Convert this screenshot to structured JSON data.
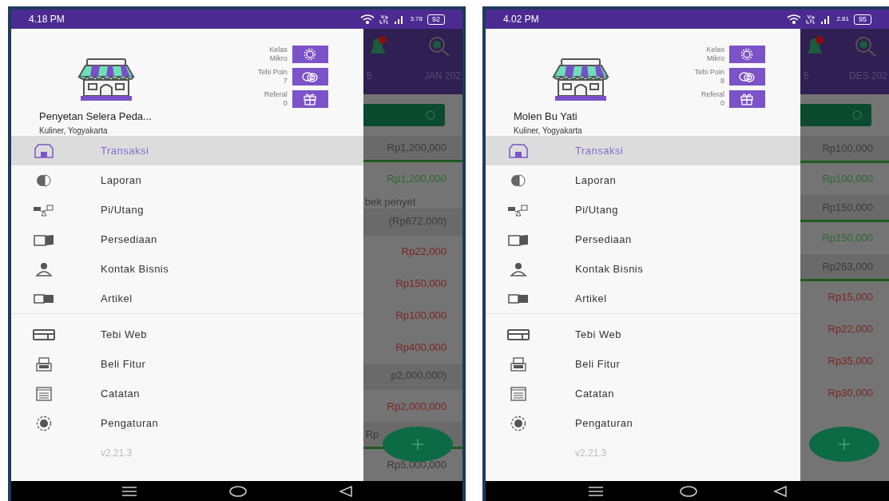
{
  "phones": [
    {
      "status_bar": {
        "time": "4.18 PM",
        "speed": "3.78",
        "battery": "92"
      },
      "background": {
        "tabs": [
          "5",
          "JAN 202"
        ],
        "rows": [
          {
            "kind": "total",
            "text": "Rp1,200,000",
            "underlined": true
          },
          {
            "kind": "amount",
            "text": "Rp1,200,000",
            "color": "#2f6a2f"
          },
          {
            "kind": "note",
            "text": "bek penyet"
          },
          {
            "kind": "total",
            "text": "(Rp672,000)",
            "underlined": false
          },
          {
            "kind": "amount",
            "text": "Rp22,000",
            "color": "#7e2424"
          },
          {
            "kind": "amount",
            "text": "Rp150,000",
            "color": "#7e2424"
          },
          {
            "kind": "amount",
            "text": "Rp100,000",
            "color": "#7e2424"
          },
          {
            "kind": "amount",
            "text": "Rp400,000",
            "color": "#7e2424"
          },
          {
            "kind": "total",
            "text": "p2,000,000)",
            "underlined": false
          },
          {
            "kind": "amount",
            "text": "Rp2,000,000",
            "color": "#7e2424"
          },
          {
            "kind": "total_cut",
            "text": "Rp",
            "underlined": true
          },
          {
            "kind": "amount",
            "text": "Rp5,000,000",
            "color": "#3a3a3a"
          }
        ]
      },
      "drawer": {
        "business_name": "Penyetan Selera Peda...",
        "business_info": "Kuliner, Yogyakarta",
        "badges": [
          {
            "label": "Kelas",
            "value": "Mikro"
          },
          {
            "label": "Tebi Poin",
            "value": "7"
          },
          {
            "label": "Referal",
            "value": "0"
          }
        ],
        "menu_groups": [
          [
            {
              "label": "Transaksi",
              "selected": true
            },
            {
              "label": "Laporan",
              "selected": false
            },
            {
              "label": "Pi/Utang",
              "selected": false
            },
            {
              "label": "Persediaan",
              "selected": false
            },
            {
              "label": "Kontak Bisnis",
              "selected": false
            },
            {
              "label": "Artikel",
              "selected": false
            }
          ],
          [
            {
              "label": "Tebi Web",
              "selected": false
            },
            {
              "label": "Beli Fitur",
              "selected": false
            },
            {
              "label": "Catatan",
              "selected": false
            },
            {
              "label": "Pengaturan",
              "selected": false
            }
          ]
        ],
        "version": "v2.21.3"
      }
    },
    {
      "status_bar": {
        "time": "4.02 PM",
        "speed": "2.81",
        "battery": "95"
      },
      "background": {
        "tabs": [
          "5",
          "DES 202"
        ],
        "rows": [
          {
            "kind": "total",
            "text": "Rp100,000",
            "underlined": true
          },
          {
            "kind": "amount",
            "text": "Rp100,000",
            "color": "#2f6a2f"
          },
          {
            "kind": "total",
            "text": "Rp150,000",
            "underlined": true
          },
          {
            "kind": "amount",
            "text": "Rp150,000",
            "color": "#2f6a2f"
          },
          {
            "kind": "total",
            "text": "Rp263,000",
            "underlined": true
          },
          {
            "kind": "amount",
            "text": "Rp15,000",
            "color": "#7e2424"
          },
          {
            "kind": "amount",
            "text": "Rp22,000",
            "color": "#7e2424"
          },
          {
            "kind": "amount",
            "text": "Rp35,000",
            "color": "#7e2424"
          },
          {
            "kind": "amount",
            "text": "Rp30,000",
            "color": "#7e2424"
          }
        ]
      },
      "drawer": {
        "business_name": "Molen Bu Yati",
        "business_info": "Kuliner, Yogyakarta",
        "badges": [
          {
            "label": "Kelas",
            "value": "Mikro"
          },
          {
            "label": "Tebi Poin",
            "value": "8"
          },
          {
            "label": "Referal",
            "value": "0"
          }
        ],
        "menu_groups": [
          [
            {
              "label": "Transaksi",
              "selected": true
            },
            {
              "label": "Laporan",
              "selected": false
            },
            {
              "label": "Pi/Utang",
              "selected": false
            },
            {
              "label": "Persediaan",
              "selected": false
            },
            {
              "label": "Kontak Bisnis",
              "selected": false
            },
            {
              "label": "Artikel",
              "selected": false
            }
          ],
          [
            {
              "label": "Tebi Web",
              "selected": false
            },
            {
              "label": "Beli Fitur",
              "selected": false
            },
            {
              "label": "Catatan",
              "selected": false
            },
            {
              "label": "Pengaturan",
              "selected": false
            }
          ]
        ],
        "version": "v2.21.3"
      }
    }
  ]
}
